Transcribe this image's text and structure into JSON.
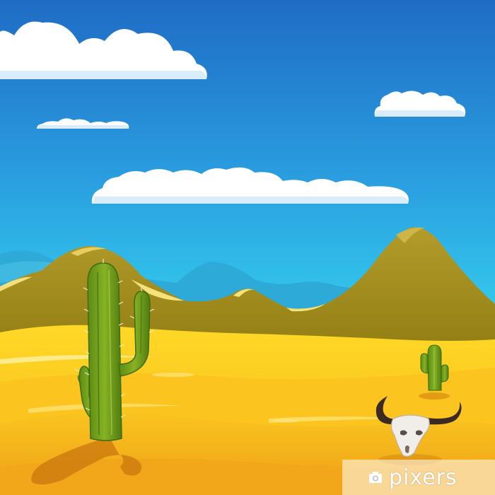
{
  "scene": {
    "type": "cartoon desert landscape illustration",
    "elements": [
      "sky",
      "clouds",
      "distant-mountains",
      "brown-hills",
      "sand-dunes",
      "large-cactus",
      "small-cactus",
      "bull-skull"
    ]
  },
  "watermark": {
    "brand": "pixers",
    "icon": "camera-icon"
  },
  "colors": {
    "sky_top": "#2173c9",
    "sky_bottom": "#33c8ea",
    "cloud": "#ffffff",
    "distant_mountain": "#2fa9da",
    "hill": "#a4901d",
    "hill_highlight": "#f7e27a",
    "sand_light": "#ffd31f",
    "sand_dark": "#f2a81a",
    "cactus": "#6f9d18",
    "cactus_dark": "#4e7a14",
    "skull": "#f0ede8",
    "horn": "#3a2a22"
  }
}
